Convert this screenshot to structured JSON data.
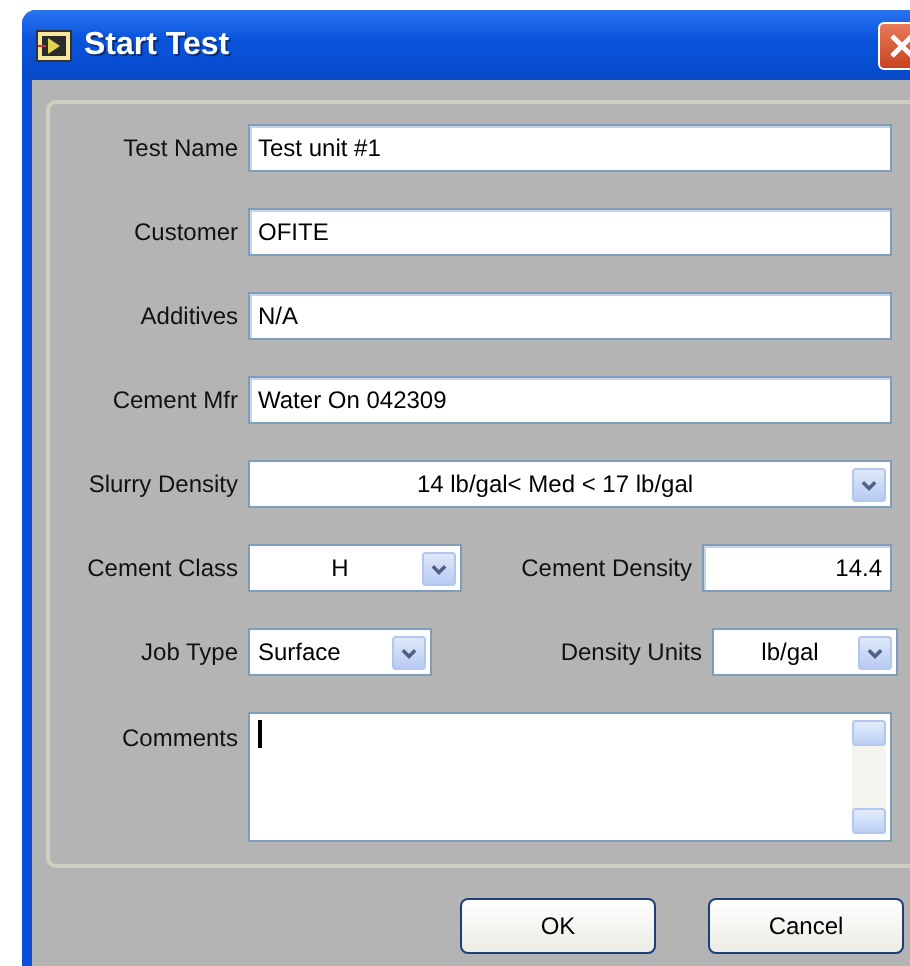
{
  "window": {
    "title": "Start Test"
  },
  "rows": [
    {
      "fields": [
        {
          "kind": "text",
          "label": "Test Name",
          "value": "Test unit #1"
        }
      ]
    },
    {
      "fields": [
        {
          "kind": "text",
          "label": "Customer",
          "value": "OFITE"
        }
      ]
    },
    {
      "fields": [
        {
          "kind": "text",
          "label": "Additives",
          "value": "N/A"
        }
      ]
    },
    {
      "fields": [
        {
          "kind": "text",
          "label": "Cement Mfr",
          "value": "Water On 042309"
        }
      ]
    },
    {
      "fields": [
        {
          "kind": "select",
          "label": "Slurry Density",
          "value": "14 lb/gal< Med < 17 lb/gal"
        }
      ]
    },
    {
      "fields": [
        {
          "kind": "select",
          "label": "Cement Class",
          "value": "H"
        },
        {
          "kind": "number",
          "label": "Cement Density",
          "value": "14.4"
        }
      ]
    },
    {
      "fields": [
        {
          "kind": "select",
          "label": "Job Type",
          "value": "Surface"
        },
        {
          "kind": "select",
          "label": "Density Units",
          "value": "lb/gal"
        }
      ]
    },
    {
      "fields": [
        {
          "kind": "textarea",
          "label": "Comments",
          "focused": true
        }
      ]
    }
  ],
  "buttons": [
    "OK",
    "Cancel"
  ]
}
